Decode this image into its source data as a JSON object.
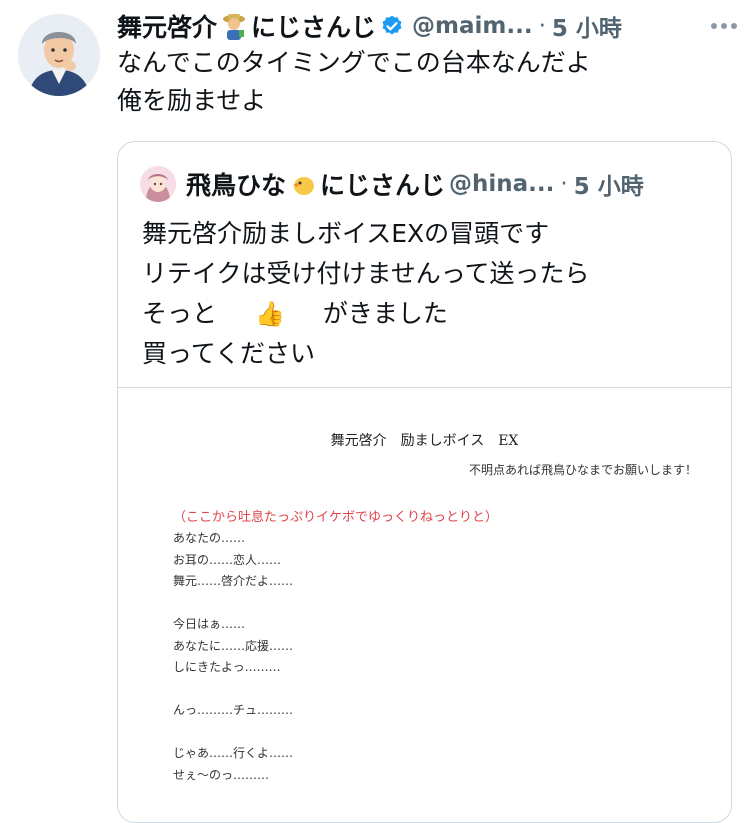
{
  "tweet": {
    "author_name": "舞元啓介",
    "author_affiliation": "にじさんじ",
    "handle": "@maim...",
    "separator": "·",
    "time": "5 小時",
    "text_lines": [
      "なんでこのタイミングでこの台本なんだよ",
      "俺を励ませよ"
    ],
    "icons": {
      "avatar": "avatar-man",
      "emoji": "farmer-emoji",
      "verified": "verified-badge-icon",
      "more": "more-icon"
    },
    "colors": {
      "verified": "#1d9bf0",
      "muted": "#536471"
    }
  },
  "quote": {
    "author_name": "飛鳥ひな",
    "author_affiliation": "にじさんじ",
    "handle": "@hina...",
    "separator": "·",
    "time": "5 小時",
    "text_lines": [
      "舞元啓介励ましボイスEXの冒頭です",
      "リテイクは受け付けませんって送ったら",
      "そっと",
      "👍",
      "がきました",
      "買ってください"
    ],
    "document": {
      "title": "舞元啓介　励ましボイス　EX",
      "note": "不明点あれば飛鳥ひなまでお願いします！",
      "direction": "（ここから吐息たっぷりイケボでゆっくりねっとりと）",
      "lines": [
        "あなたの……",
        "お耳の……恋人……",
        "舞元……啓介だよ……",
        "",
        "今日はぁ……",
        "あなたに……応援……",
        "しにきたよっ………",
        "",
        "んっ………チュ………",
        "",
        "じゃあ……行くよ……",
        "せぇ～のっ………"
      ],
      "colors": {
        "direction": "#e0454a"
      }
    }
  }
}
